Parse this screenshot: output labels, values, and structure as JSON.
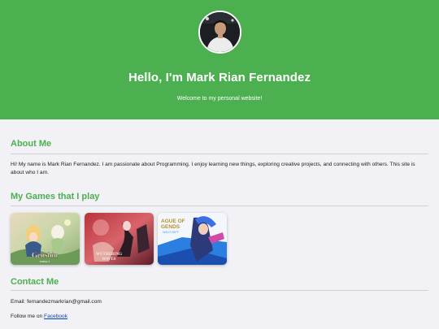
{
  "header": {
    "avatar_icon": "profile-photo",
    "title": "Hello, I'm Mark Rian Fernandez",
    "subtitle": "Welcome to my personal website!",
    "background": "#4caf50"
  },
  "about": {
    "title": "About Me",
    "text": "Hi! My name is Mark Rian Fernandez. I am passionate about Programming. I enjoy learning new things, exploring creative projects, and connecting with others. This site is about who I am."
  },
  "games": {
    "title": "My Games that I play",
    "items": [
      {
        "logo_line1": "Genshin",
        "logo_line2": "IMPACT"
      },
      {
        "logo_line1": "WUTHERING",
        "logo_line2": "WAVES"
      },
      {
        "logo_line1": "AGUE OF",
        "logo_line2": "GENDS",
        "logo_line3": "WILD RIFT"
      }
    ]
  },
  "contact": {
    "title": "Contact Me",
    "email_label": "Email: fernandezmarkrian@gmail.com",
    "follow_prefix": "Follow me on ",
    "facebook_link": "Facebook"
  },
  "colors": {
    "accent": "#4caf50",
    "page_bg": "#f1f1f6",
    "link": "#0645ad"
  }
}
